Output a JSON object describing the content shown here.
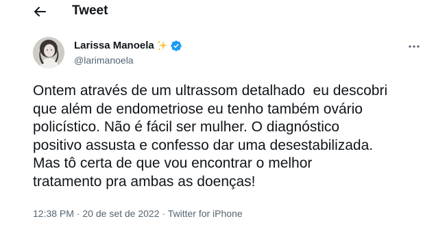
{
  "header": {
    "title": "Tweet",
    "back_icon": "arrow-left-icon"
  },
  "author": {
    "display_name": "Larissa Manoela",
    "name_emoji": "sparkles-icon",
    "verified_icon": "verified-badge-icon",
    "verified_color": "#1d9bf0",
    "handle": "@larimanoela"
  },
  "more_icon": "more-dots-icon",
  "tweet": {
    "text": "Ontem através de um ultrassom detalhado  eu descobri\nque além de endometriose eu tenho também ovário\npolicístico. Não é fácil ser mulher. O diagnóstico\npositivo assusta e confesso dar uma desestabilizada.\nMas tô certa de que vou encontrar o melhor\ntratamento pra ambas as doenças!"
  },
  "meta": {
    "time": "12:38 PM",
    "separator": " · ",
    "date": "20 de set de 2022",
    "source": "Twitter for iPhone"
  },
  "colors": {
    "text_primary": "#0f1419",
    "text_secondary": "#536471",
    "accent": "#1d9bf0",
    "sparkle": "#f4c542"
  }
}
